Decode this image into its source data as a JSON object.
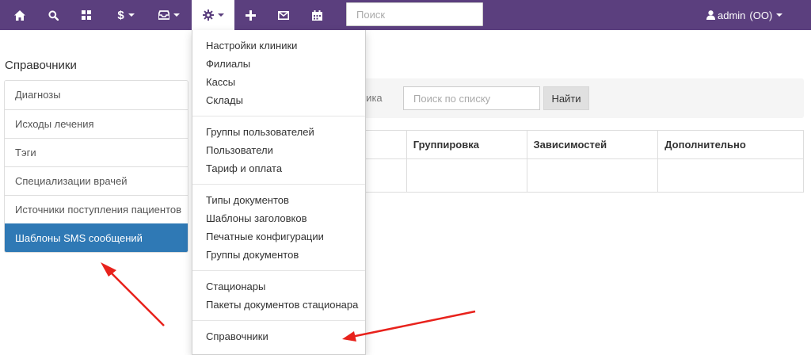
{
  "navbar": {
    "search_placeholder": "Поиск",
    "user_name": "admin",
    "user_org": "(ОО)"
  },
  "icons": [
    "home-icon",
    "search-icon",
    "grid-icon",
    "dollar-icon",
    "inbox-icon",
    "gear-icon",
    "plus-icon",
    "envelope-icon",
    "calendar-icon",
    "user-icon"
  ],
  "dropdown": {
    "groups": [
      [
        "Настройки клиники",
        "Филиалы",
        "Кассы",
        "Склады"
      ],
      [
        "Группы пользователей",
        "Пользователи",
        "Тариф и оплата"
      ],
      [
        "Типы документов",
        "Шаблоны заголовков",
        "Печатные конфигурации",
        "Группы документов"
      ],
      [
        "Стационары",
        "Пакеты документов стационара"
      ],
      [
        "Справочники"
      ]
    ]
  },
  "sidebar": {
    "title": "Справочники",
    "items": [
      {
        "label": "Диагнозы",
        "active": false
      },
      {
        "label": "Исходы лечения",
        "active": false
      },
      {
        "label": "Тэги",
        "active": false
      },
      {
        "label": "Специализации врачей",
        "active": false
      },
      {
        "label": "Источники поступления пациентов",
        "active": false
      },
      {
        "label": "Шаблоны SMS сообщений",
        "active": true
      }
    ]
  },
  "filter": {
    "label_fragment": "ника",
    "search_placeholder": "Поиск по списку",
    "find_label": "Найти"
  },
  "table": {
    "columns": [
      "",
      "Группировка",
      "Зависимостей",
      "Дополнительно"
    ]
  },
  "colors": {
    "navbar": "#5b3f7e",
    "active_item": "#2f79b5",
    "arrow": "#e8221c"
  }
}
